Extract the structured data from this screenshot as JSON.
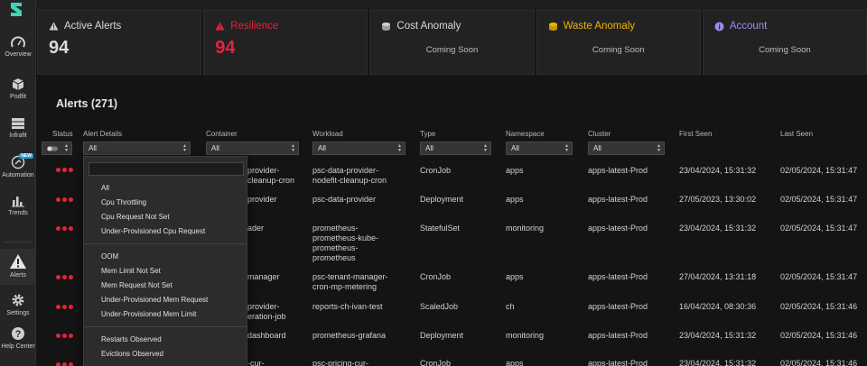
{
  "sidebar": {
    "logo": "logo",
    "items": [
      {
        "label": "Overview",
        "icon": "gauge-icon"
      },
      {
        "label": "Podfit",
        "icon": "cube-icon"
      },
      {
        "label": "Infrafit",
        "icon": "server-icon"
      },
      {
        "label": "Automation",
        "icon": "automation-icon",
        "badge": "NEW"
      },
      {
        "label": "Trends",
        "icon": "bar-chart-icon"
      },
      {
        "label": "Alerts",
        "icon": "warning-icon"
      },
      {
        "label": "Settings",
        "icon": "gear-icon"
      },
      {
        "label": "Help Center",
        "icon": "help-icon"
      }
    ]
  },
  "cards": [
    {
      "title": "Active Alerts",
      "value": "94",
      "icon": "warning-icon",
      "color": "#d9d9d9"
    },
    {
      "title": "Resilience",
      "value": "94",
      "icon": "warning-icon",
      "color": "#e2243c"
    },
    {
      "title": "Cost Anomaly",
      "status": "Coming Soon",
      "icon": "coins-icon",
      "color": "#d9d9d9"
    },
    {
      "title": "Waste Anomaly",
      "status": "Coming Soon",
      "icon": "coins-icon",
      "color": "#f0b400"
    },
    {
      "title": "Account",
      "status": "Coming Soon",
      "icon": "info-icon",
      "color": "#9c8cf0"
    }
  ],
  "alerts": {
    "title": "Alerts (271)",
    "columns": [
      "Status",
      "Alert Details",
      "Container",
      "Workload",
      "Type",
      "Namespace",
      "Cluster",
      "First Seen",
      "Last Seen"
    ],
    "filters": {
      "alert_details": "All",
      "container": "All",
      "workload": "All",
      "type": "All",
      "namespace": "All",
      "cluster": "All"
    },
    "rows": [
      {
        "container": [
          "provider-",
          "cleanup-cron"
        ],
        "workload": [
          "psc-data-provider-",
          "nodefit-cleanup-cron"
        ],
        "type": "CronJob",
        "namespace": "apps",
        "cluster": "apps-latest-Prod",
        "first_seen": "23/04/2024, 15:31:32",
        "last_seen": "02/05/2024, 15:31:47"
      },
      {
        "container": [
          "provider"
        ],
        "workload": [
          "psc-data-provider"
        ],
        "type": "Deployment",
        "namespace": "apps",
        "cluster": "apps-latest-Prod",
        "first_seen": "27/05/2023, 13:30:02",
        "last_seen": "02/05/2024, 15:31:47"
      },
      {
        "container": [
          "ader"
        ],
        "workload": [
          "prometheus-",
          "prometheus-kube-",
          "prometheus-",
          "prometheus"
        ],
        "type": "StatefulSet",
        "namespace": "monitoring",
        "cluster": "apps-latest-Prod",
        "first_seen": "23/04/2024, 15:31:32",
        "last_seen": "02/05/2024, 15:31:47"
      },
      {
        "container": [
          "manager"
        ],
        "workload": [
          "psc-tenant-manager-",
          "cron-mp-metering"
        ],
        "type": "CronJob",
        "namespace": "apps",
        "cluster": "apps-latest-Prod",
        "first_seen": "27/04/2024, 13:31:18",
        "last_seen": "02/05/2024, 15:31:47"
      },
      {
        "container": [
          "provider-",
          "eration-job"
        ],
        "workload": [
          "reports-ch-ivan-test"
        ],
        "type": "ScaledJob",
        "namespace": "ch",
        "cluster": "apps-latest-Prod",
        "first_seen": "16/04/2024, 08:30:36",
        "last_seen": "02/05/2024, 15:31:46"
      },
      {
        "container": [
          "dashboard"
        ],
        "workload": [
          "prometheus-grafana"
        ],
        "type": "Deployment",
        "namespace": "monitoring",
        "cluster": "apps-latest-Prod",
        "first_seen": "23/04/2024, 15:31:32",
        "last_seen": "02/05/2024, 15:31:46"
      },
      {
        "container": [
          "-cur-"
        ],
        "workload": [
          "psc-pricing-cur-"
        ],
        "type": "CronJob",
        "namespace": "apps",
        "cluster": "apps-latest-Prod",
        "first_seen": "23/04/2024, 15:31:32",
        "last_seen": "02/05/2024, 15:31:46"
      }
    ]
  },
  "dropdown": {
    "options": [
      "All",
      "Cpu Throttling",
      "Cpu Request Not Set",
      "Under-Provisioned Cpu Request",
      "OOM",
      "Mem Limit Not Set",
      "Mem Request Not Set",
      "Under-Provisioned Mem Request",
      "Under-Provisioned Mem Limit",
      "Restarts Observed",
      "Evictions Observed"
    ]
  }
}
